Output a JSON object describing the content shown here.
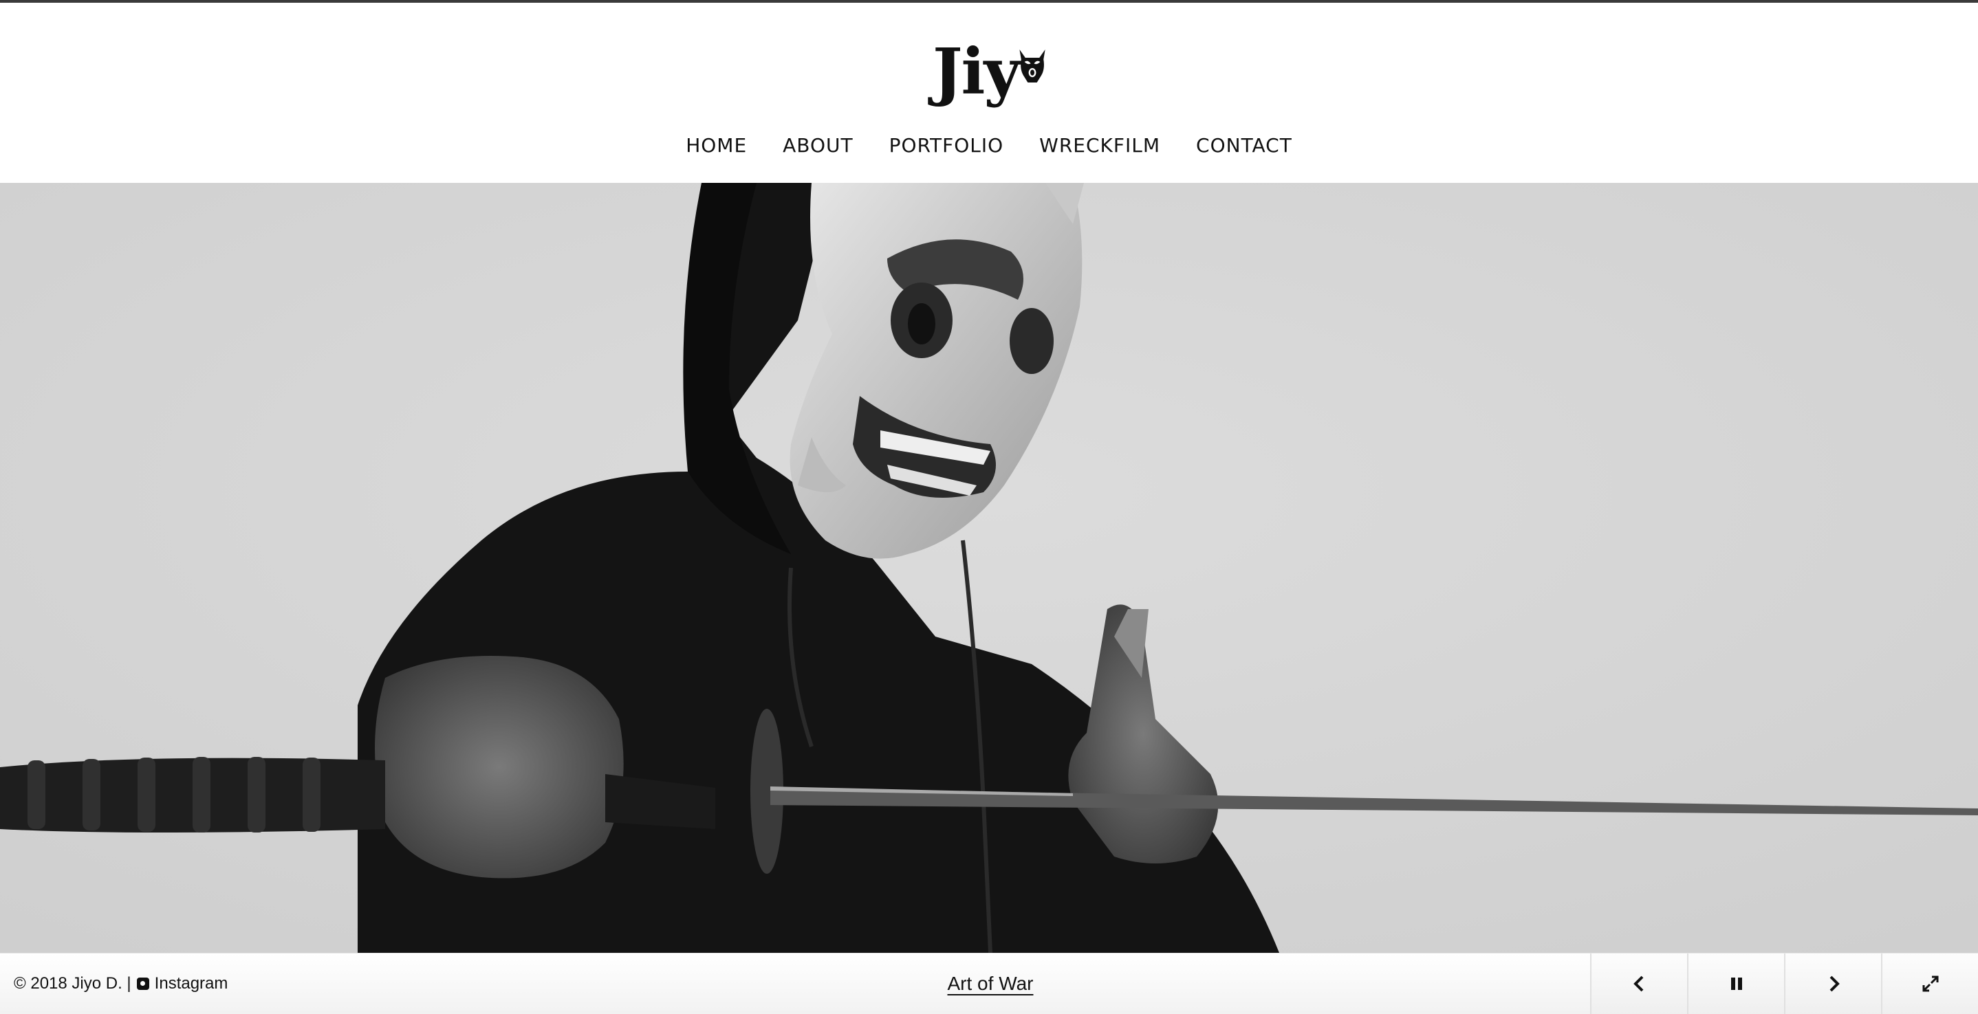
{
  "logo": {
    "text": "Jiy"
  },
  "nav": {
    "items": [
      {
        "label": "HOME"
      },
      {
        "label": "ABOUT"
      },
      {
        "label": "PORTFOLIO"
      },
      {
        "label": "WRECKFILM"
      },
      {
        "label": "CONTACT"
      }
    ]
  },
  "footer": {
    "copyright": "© 2018 Jiyo D. |",
    "instagram_label": "Instagram",
    "caption": "Art of War"
  },
  "controls": {
    "prev_icon": "chevron-left-icon",
    "pause_icon": "pause-icon",
    "next_icon": "chevron-right-icon",
    "fullscreen_icon": "expand-icon"
  },
  "colors": {
    "header_bg": "#ffffff",
    "text": "#111111",
    "hero_bg": "#d6d6d6"
  }
}
